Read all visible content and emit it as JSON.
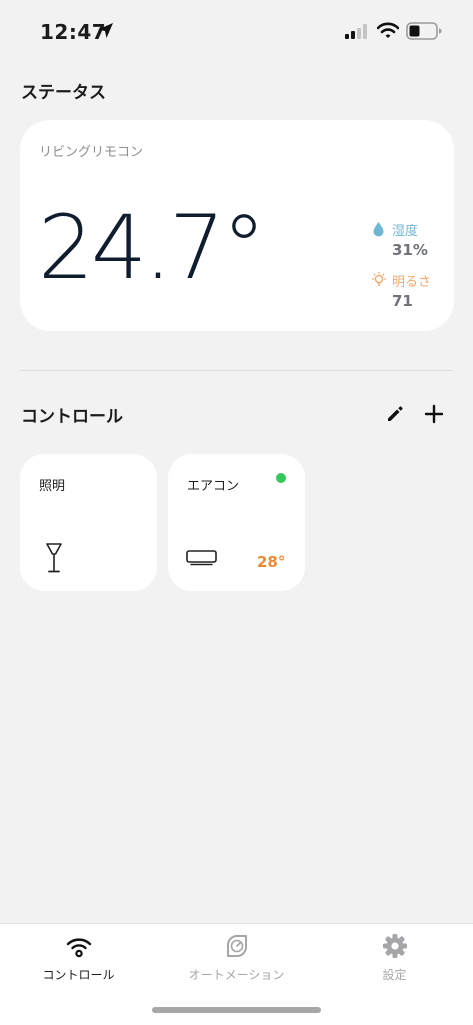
{
  "status_bar": {
    "time": "12:47",
    "icons": [
      "location-arrow-icon",
      "cellular-signal-icon",
      "wifi-icon",
      "battery-icon"
    ]
  },
  "status_section": {
    "title": "ステータス",
    "card": {
      "device_name": "リビングリモコン",
      "temperature": "24.7°",
      "humidity_label": "湿度",
      "humidity_value": "31%",
      "brightness_label": "明るさ",
      "brightness_value": "71"
    }
  },
  "control_section": {
    "title": "コントロール",
    "actions": [
      "pencil-icon",
      "plus-icon"
    ],
    "tiles": [
      {
        "label": "照明",
        "icon": "lamp-icon"
      },
      {
        "label": "エアコン",
        "icon": "air-conditioner-icon",
        "status": "online",
        "temperature": "28°"
      }
    ]
  },
  "tab_bar": {
    "items": [
      {
        "label": "コントロール",
        "icon": "wifi-icon",
        "active": true
      },
      {
        "label": "オートメーション",
        "icon": "gauge-icon",
        "active": false
      },
      {
        "label": "設定",
        "icon": "gear-icon",
        "active": false
      }
    ]
  },
  "colors": {
    "background": "#f2f2f2",
    "card": "#ffffff",
    "humidity": "#6fb7d3",
    "brightness": "#f1a86d",
    "ac_temperature": "#eb8a36",
    "online": "#34c759",
    "tab_inactive": "#a5a5aa"
  }
}
